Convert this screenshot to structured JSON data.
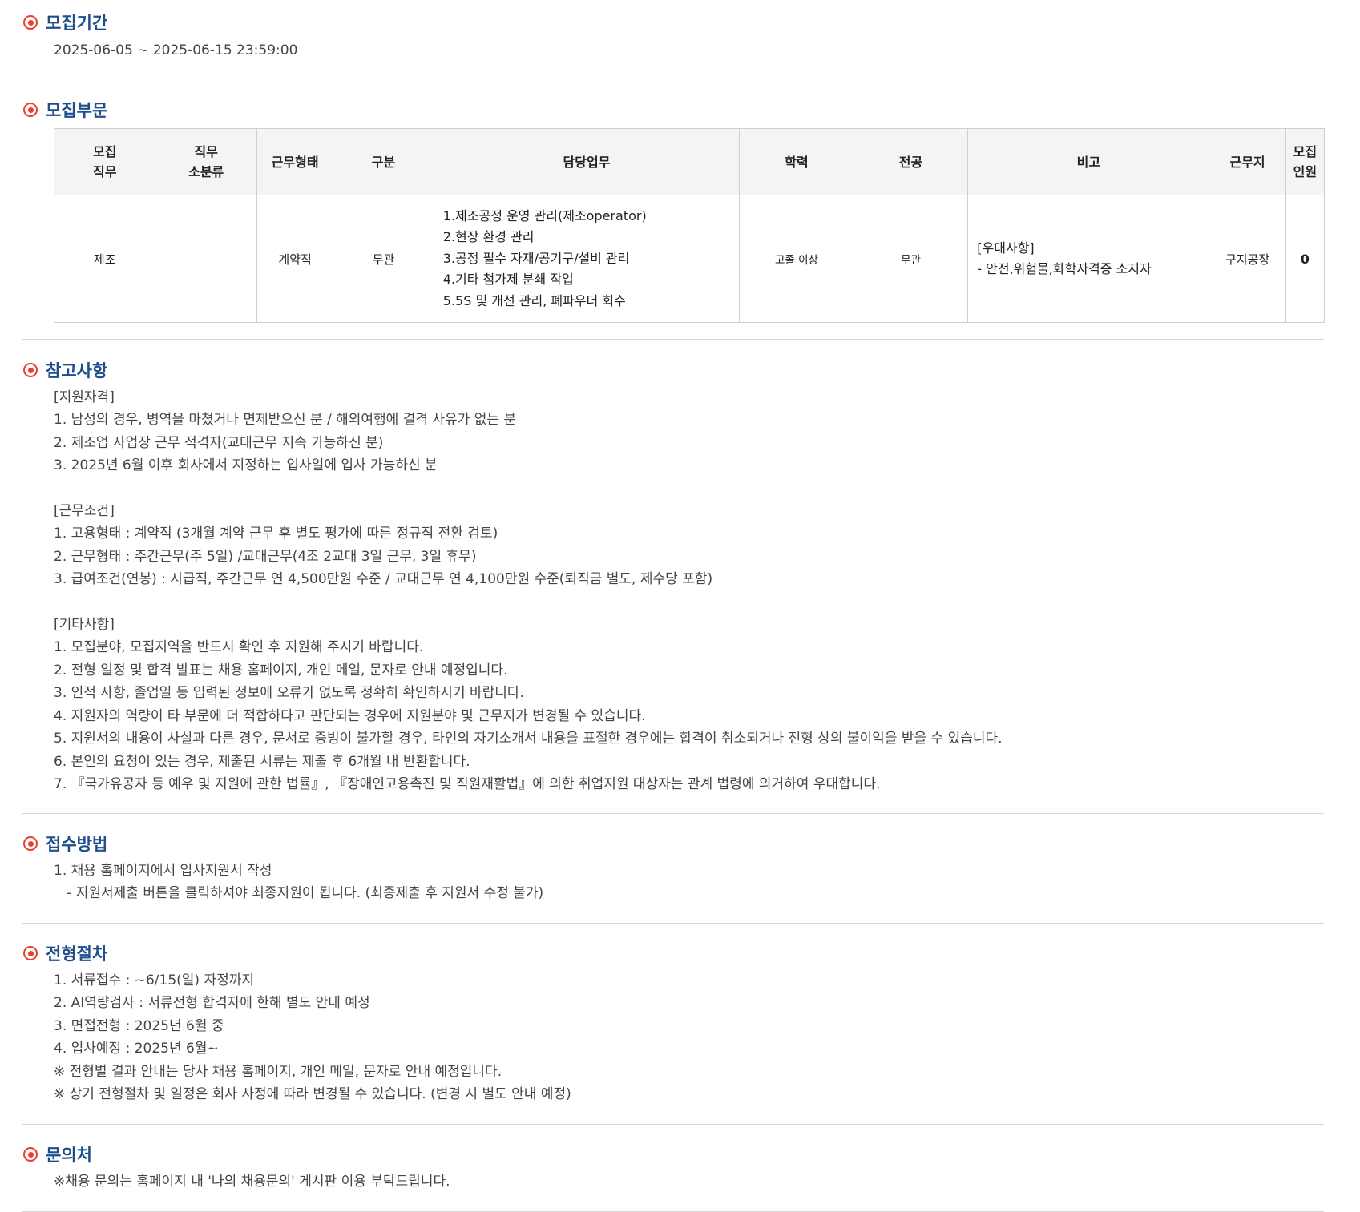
{
  "period": {
    "title": "모집기간",
    "value": "2025-06-05 ~ 2025-06-15 23:59:00"
  },
  "division": {
    "title": "모집부문",
    "headers": [
      "모집\n직무",
      "직무\n소분류",
      "근무형태",
      "구분",
      "담당업무",
      "학력",
      "전공",
      "비고",
      "근무지",
      "모집\n인원"
    ],
    "row": {
      "job": "제조",
      "sub": "",
      "type": "계약직",
      "category": "무관",
      "duties": [
        "1.제조공정 운영 관리(제조operator)",
        "2.현장 환경 관리",
        "3.공정 필수 자재/공기구/설비 관리",
        "4.기타 첨가제 분쇄 작업",
        "5.5S 및 개선 관리, 폐파우더 회수"
      ],
      "education": "고졸 이상",
      "major": "무관",
      "notes": [
        "[우대사항]",
        "- 안전,위험물,화학자격증 소지자"
      ],
      "location": "구지공장",
      "count": "0"
    }
  },
  "reference": {
    "title": "참고사항",
    "lines": [
      "[지원자격]",
      "1. 남성의 경우, 병역을 마쳤거나 면제받으신 분 / 해외여행에 결격 사유가 없는 분",
      "2. 제조업 사업장 근무 적격자(교대근무 지속 가능하신 분)",
      "3. 2025년 6월 이후 회사에서 지정하는 입사일에 입사 가능하신 분",
      "",
      "[근무조건]",
      "1. 고용형태 : 계약직 (3개월 계약 근무 후 별도 평가에 따른 정규직 전환 검토)",
      "2. 근무형태 : 주간근무(주 5일) /교대근무(4조 2교대 3일 근무, 3일 휴무)",
      "3. 급여조건(연봉) : 시급직, 주간근무 연 4,500만원 수준 / 교대근무 연 4,100만원 수준(퇴직금 별도, 제수당 포함)",
      "",
      "[기타사항]",
      "1. 모집분야, 모집지역을 반드시 확인 후 지원해 주시기 바랍니다.",
      "2. 전형 일정 및 합격 발표는 채용 홈페이지, 개인 메일, 문자로 안내 예정입니다.",
      "3. 인적 사항, 졸업일 등 입력된 정보에 오류가 없도록 정확히 확인하시기 바랍니다.",
      "4. 지원자의 역량이 타 부문에 더 적합하다고 판단되는 경우에 지원분야 및 근무지가 변경될 수 있습니다.",
      "5. 지원서의 내용이 사실과 다른 경우, 문서로 증빙이 불가할 경우, 타인의 자기소개서 내용을 표절한 경우에는 합격이 취소되거나 전형 상의 불이익을 받을 수 있습니다.",
      "6. 본인의 요청이 있는 경우, 제출된 서류는 제출 후 6개월 내 반환합니다.",
      "7. 『국가유공자 등 예우 및 지원에 관한 법률』, 『장애인고용촉진 및 직원재활법』에 의한 취업지원 대상자는 관계 법령에 의거하여 우대합니다."
    ]
  },
  "application": {
    "title": "접수방법",
    "lines": [
      "1. 채용 홈페이지에서 입사지원서 작성",
      "   - 지원서제출 버튼을 클릭하셔야 최종지원이 됩니다. (최종제출 후 지원서 수정 불가)"
    ]
  },
  "process": {
    "title": "전형절차",
    "lines": [
      "1. 서류접수 : ~6/15(일) 자정까지",
      "2. AI역량검사 : 서류전형 합격자에 한해 별도 안내 예정",
      "3. 면접전형 : 2025년 6월 중",
      "4. 입사예정 : 2025년 6월~",
      "※ 전형별 결과 안내는 당사 채용 홈페이지, 개인 메일, 문자로 안내 예정입니다.",
      "※ 상기 전형절차 및 일정은 회사 사정에 따라 변경될 수 있습니다. (변경 시 별도 안내 예정)"
    ]
  },
  "contact": {
    "title": "문의처",
    "lines": [
      "※채용 문의는 홈페이지 내 '나의 채용문의' 게시판 이용 부탁드립니다."
    ]
  }
}
